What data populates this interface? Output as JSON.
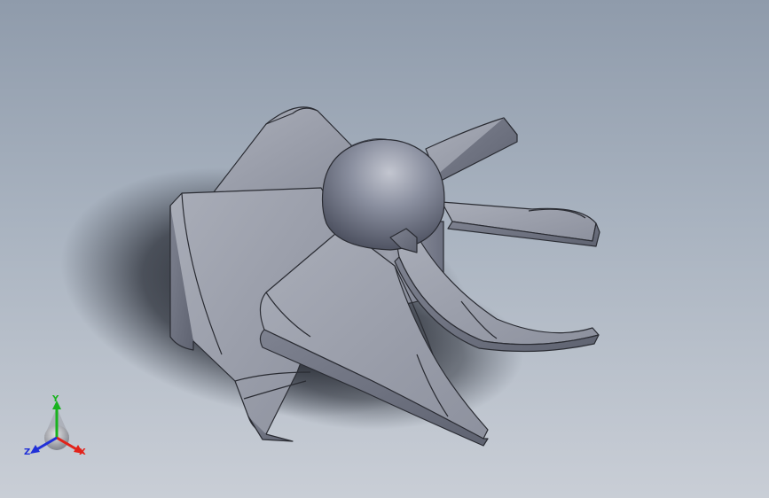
{
  "viewport": {
    "background_top": "#8f9bab",
    "background_bottom": "#c9ced6",
    "model": {
      "type": "fan-impeller",
      "blade_count": 6,
      "body_color": "#9a9fab",
      "edge_color": "#2a2c33"
    }
  },
  "triad": {
    "x_label": "X",
    "y_label": "Y",
    "z_label": "Z",
    "x_color": "#e2231a",
    "y_color": "#19b31e",
    "z_color": "#2030d8"
  }
}
